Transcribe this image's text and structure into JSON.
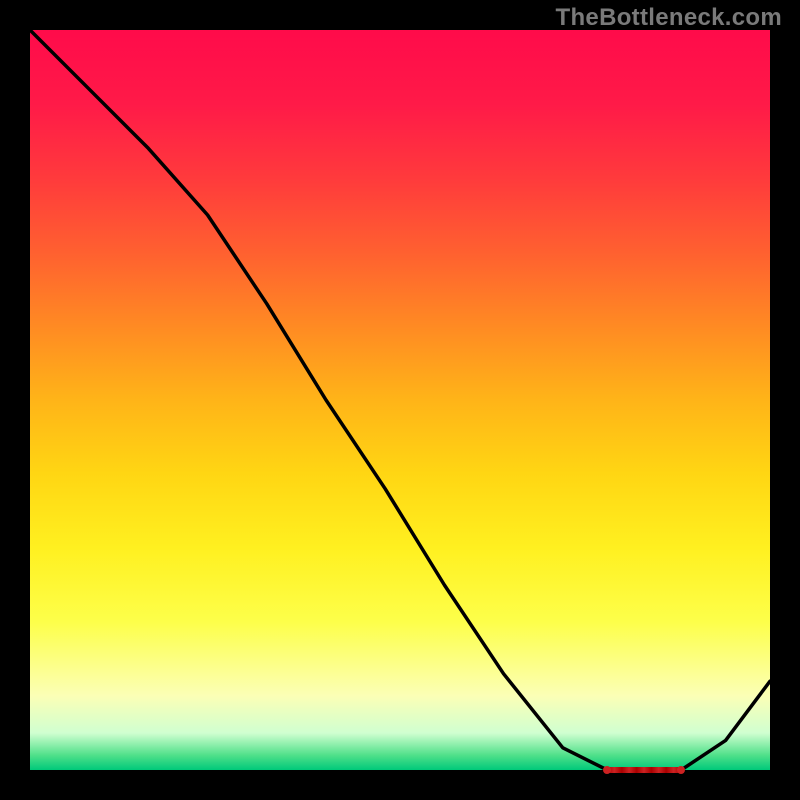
{
  "attribution": "TheBottleneck.com",
  "chart_data": {
    "type": "line",
    "title": "",
    "xlabel": "",
    "ylabel": "",
    "xlim": [
      0,
      100
    ],
    "ylim": [
      0,
      100
    ],
    "x": [
      0,
      8,
      16,
      24,
      32,
      40,
      48,
      56,
      64,
      72,
      78,
      83,
      88,
      94,
      100
    ],
    "values": [
      100,
      92,
      84,
      75,
      63,
      50,
      38,
      25,
      13,
      3,
      0,
      0,
      0,
      4,
      12
    ],
    "flat_segment": {
      "x_start": 78,
      "x_end": 88,
      "y": 0
    }
  }
}
